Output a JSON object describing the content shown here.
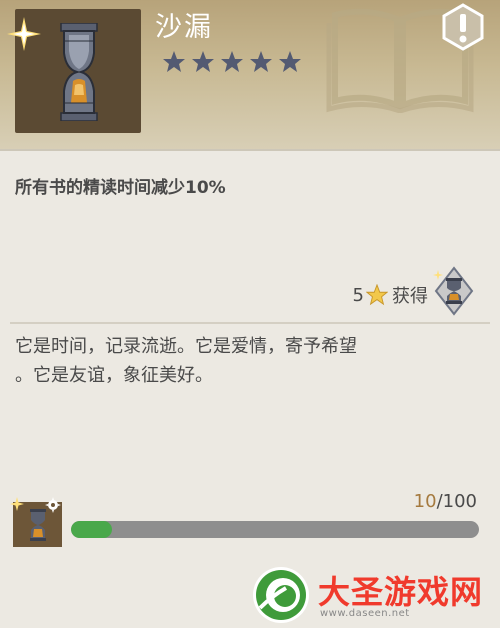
{
  "item": {
    "name": "沙漏",
    "stars_total": 5,
    "stars_filled": 5,
    "effect": "所有书的精读时间减少10%",
    "description_line1": "它是时间，记录流逝。它是爱情，寄予希望",
    "description_line2": "。它是友谊，象征美好。",
    "icon": "hourglass-icon"
  },
  "obtain": {
    "stars": "5",
    "label": "获得"
  },
  "progress": {
    "current": "10",
    "separator": "/",
    "max": "100",
    "fraction": 0.1
  },
  "colors": {
    "star_filled": "#535a72",
    "bar_fill": "#49a84a",
    "bar_track": "#8e8e8e",
    "accent_count": "#a57a3f",
    "watermark_red": "#f03a2c"
  },
  "watermark": {
    "title": "大圣游戏网",
    "url": "www.daseen.net"
  }
}
